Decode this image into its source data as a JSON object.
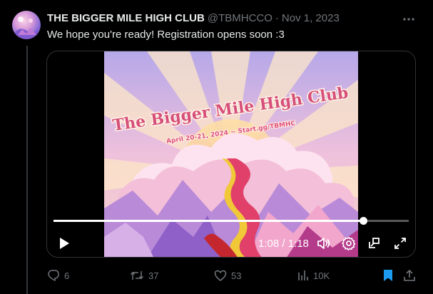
{
  "tweet": {
    "display_name": "THE BIGGER MILE HIGH CLUB",
    "handle": "@TBMHCCO",
    "separator": "·",
    "date": "Nov 1, 2023",
    "text": "We hope you're ready! Registration opens soon :3"
  },
  "video": {
    "art_title": "The Bigger Mile High Club",
    "art_subtitle": "April 20-21, 2024 ~ Start.gg/TBMHC",
    "time_display": "1:08 / 1:18",
    "progress_fraction": 0.872
  },
  "actions": {
    "replies": "6",
    "reposts": "37",
    "likes": "53",
    "views": "10K"
  },
  "colors": {
    "muted": "#71767b",
    "bookmark_active": "#1d9bf0",
    "background": "#000000"
  }
}
